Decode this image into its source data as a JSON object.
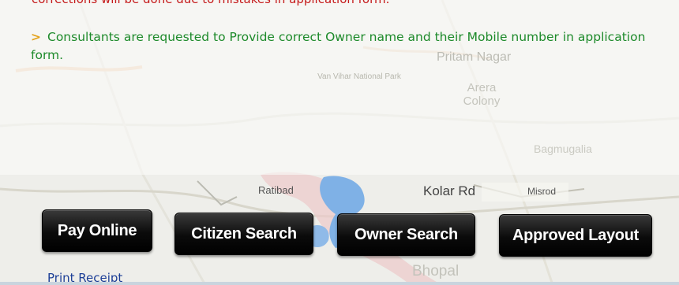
{
  "notices": {
    "red_text": "corrections will be done due to mistakes in application form.",
    "green_text": "Consultants are requested to Provide correct Owner name and their Mobile number in application form.",
    "bullet": ">"
  },
  "map": {
    "labels": [
      "Pritam Nagar",
      "Van Vihar National Park",
      "Arera Colony",
      "Ratibad",
      "Kolar Rd",
      "Misrod",
      "Bagmugalia",
      "Bhopal"
    ]
  },
  "actions": {
    "pay_online": "Pay Online",
    "citizen_search": "Citizen Search",
    "owner_search": "Owner Search",
    "approved_layout": "Approved Layout",
    "print_receipt": "Print Receipt"
  },
  "colors": {
    "notice_red": "#c51b1b",
    "notice_green": "#1d8a2a",
    "link": "#1d3f97",
    "button": "#000000"
  }
}
